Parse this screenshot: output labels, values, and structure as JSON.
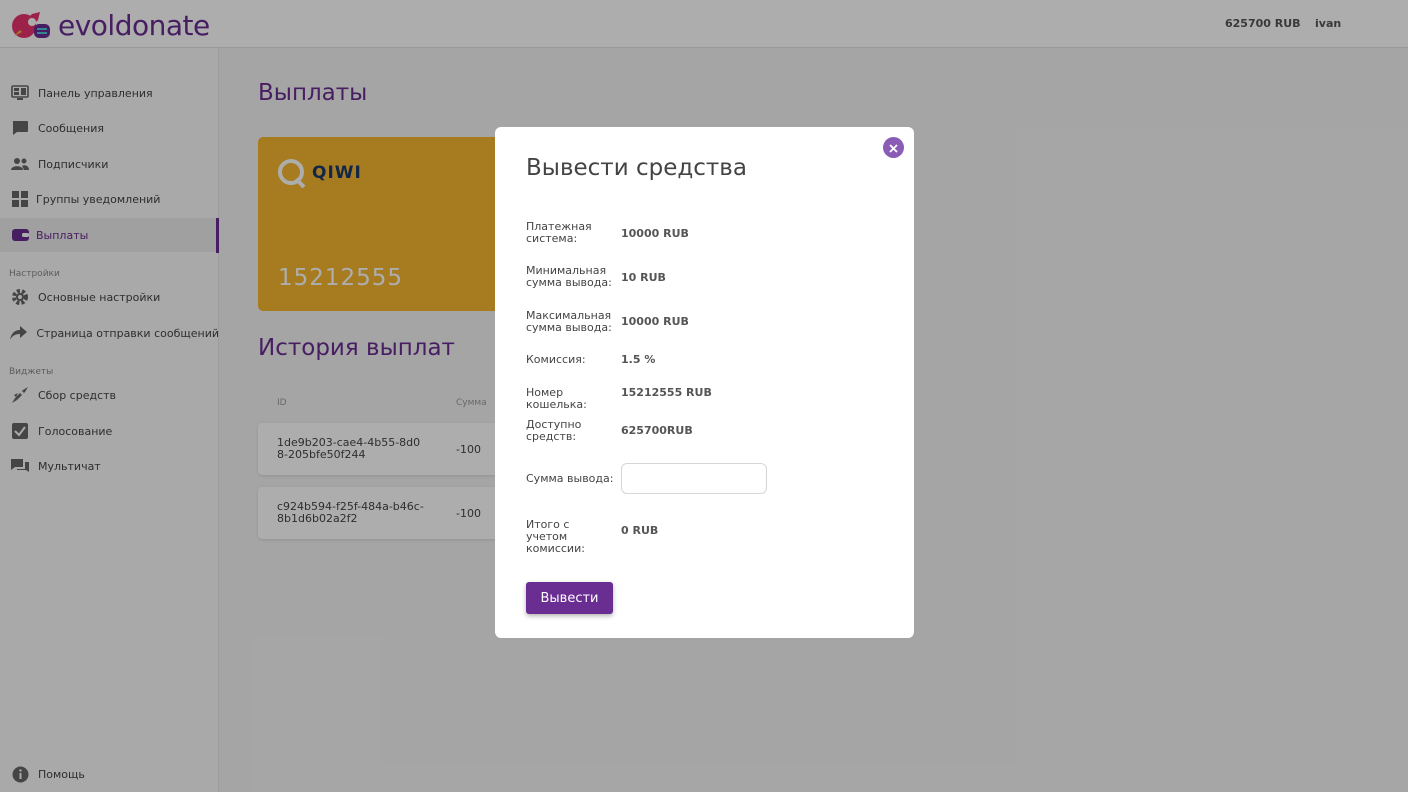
{
  "header": {
    "logo_text": "evoldonate",
    "balance": "625700 RUB",
    "username": "ivan"
  },
  "sidebar": {
    "items": [
      {
        "label": "Панель управления",
        "icon": "dashboard-icon"
      },
      {
        "label": "Сообщения",
        "icon": "message-icon"
      },
      {
        "label": "Подписчики",
        "icon": "users-icon"
      },
      {
        "label": "Группы уведомлений",
        "icon": "grid-icon"
      },
      {
        "label": "Выплаты",
        "icon": "wallet-icon",
        "active": true
      }
    ],
    "settings_label": "Настройки",
    "settings_items": [
      {
        "label": "Основные настройки",
        "icon": "gear-icon"
      },
      {
        "label": "Страница отправки сообщений",
        "icon": "share-icon"
      }
    ],
    "widgets_label": "Виджеты",
    "widget_items": [
      {
        "label": "Сбор средств",
        "icon": "rocket-icon"
      },
      {
        "label": "Голосование",
        "icon": "checkbox-icon"
      },
      {
        "label": "Мультичат",
        "icon": "chat-icon"
      }
    ],
    "help_label": "Помощь"
  },
  "main": {
    "title": "Выплаты",
    "card": {
      "brand": "QIWI",
      "number": "15212555"
    },
    "history_title": "История выплат",
    "table": {
      "headers": [
        "ID",
        "Сумма"
      ],
      "rows": [
        {
          "id": "1de9b203-cae4-4b55-8d08-205bfe50f244",
          "amount": "-100"
        },
        {
          "id": "c924b594-f25f-484a-b46c-8b1d6b02a2f2",
          "amount": "-100"
        }
      ]
    }
  },
  "modal": {
    "title": "Вывести средства",
    "fields": [
      {
        "label": "Платежная система:",
        "value": "10000 RUB"
      },
      {
        "label": "Минимальная сумма вывода:",
        "value": "10 RUB"
      },
      {
        "label": "Максимальная сумма вывода:",
        "value": "10000 RUB"
      },
      {
        "label": "Комиссия:",
        "value": "1.5 %"
      },
      {
        "label": "Номер кошелька:",
        "value": "15212555 RUB"
      },
      {
        "label": "Доступно средств:",
        "value": "625700RUB"
      }
    ],
    "amount_label": "Сумма вывода:",
    "amount_value": "",
    "total_label": "Итого с учетом комиссии:",
    "total_value": "0 RUB",
    "submit_label": "Вывести"
  },
  "colors": {
    "brand_purple": "#6a2d91",
    "qiwi_card": "#f7b731",
    "close_button": "#8a5cb5"
  }
}
